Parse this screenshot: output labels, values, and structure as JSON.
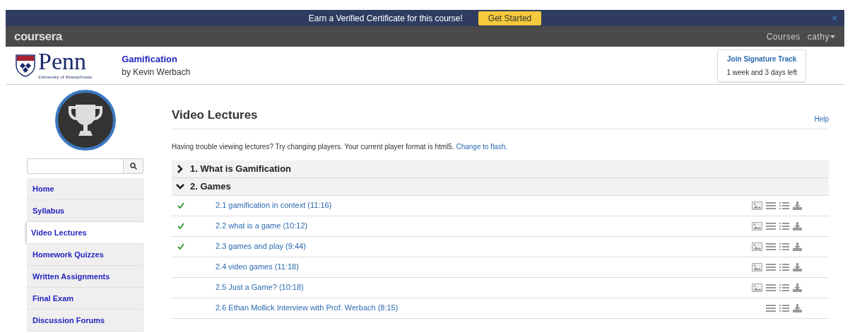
{
  "banner": {
    "text": "Earn a Verified Certificate for this course!",
    "button": "Get Started",
    "close": "×"
  },
  "topbar": {
    "logo": "coursera",
    "links": [
      "Courses",
      "cathy"
    ]
  },
  "header": {
    "university": "Penn",
    "university_sub": "University of Pennsylvania",
    "course": "Gamification",
    "instructor": "by Kevin Werbach",
    "signature": {
      "title": "Join Signature Track",
      "note": "1 week and 3 days left"
    }
  },
  "sidebar": {
    "items": [
      {
        "label": "Home",
        "selected": false
      },
      {
        "label": "Syllabus",
        "selected": false
      },
      {
        "label": "Video Lectures",
        "selected": true
      },
      {
        "label": "Homework Quizzes",
        "selected": false
      },
      {
        "label": "Written Assignments",
        "selected": false
      },
      {
        "label": "Final Exam",
        "selected": false
      },
      {
        "label": "Discussion Forums",
        "selected": false
      }
    ]
  },
  "main": {
    "title": "Video Lectures",
    "help": "Help",
    "notice": "Having trouble viewing lectures? Try changing players. Your current player format is html5.",
    "notice_link": "Change to flash.",
    "sections": [
      {
        "title": "1. What is Gamification",
        "expanded": false
      },
      {
        "title": "2. Games",
        "expanded": true,
        "lectures": [
          {
            "title": "2.1 gamification in context (11:16)",
            "watched": true,
            "slides": true
          },
          {
            "title": "2.2 what is a game (10:12)",
            "watched": true,
            "slides": true
          },
          {
            "title": "2.3 games and play (9:44)",
            "watched": true,
            "slides": true
          },
          {
            "title": "2.4 video games (11:18)",
            "watched": false,
            "slides": true
          },
          {
            "title": "2.5 Just a Game? (10:18)",
            "watched": false,
            "slides": true
          },
          {
            "title": "2.6 Ethan Mollick Interview with Prof. Werbach (8:15)",
            "watched": false,
            "slides": false
          }
        ]
      }
    ]
  }
}
